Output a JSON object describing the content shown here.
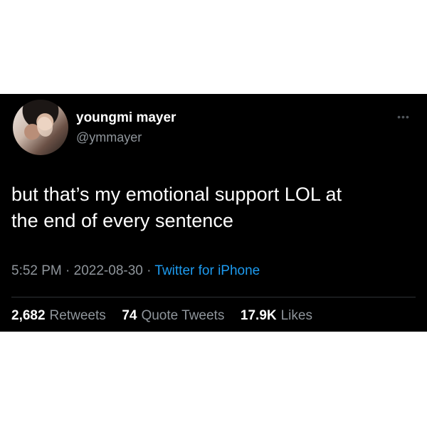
{
  "tweet": {
    "author": {
      "display_name": "youngmi mayer",
      "handle": "@ymmayer"
    },
    "text_lines": [
      "but that’s my emotional support LOL at",
      "the end of every sentence"
    ],
    "time": "5:52 PM",
    "date": "2022-08-30",
    "separator": "·",
    "source": "Twitter for iPhone",
    "stats": {
      "retweets_count": "2,682",
      "retweets_label": "Retweets",
      "quote_tweets_count": "74",
      "quote_tweets_label": "Quote Tweets",
      "likes_count": "17.9K",
      "likes_label": "Likes"
    },
    "icons": {
      "avatar": "profile-avatar",
      "more": "more-icon"
    },
    "colors": {
      "background": "#000000",
      "primary_text": "#ffffff",
      "secondary_text": "#8f959b",
      "link": "#1d9bf0",
      "divider": "#2f3336"
    }
  }
}
